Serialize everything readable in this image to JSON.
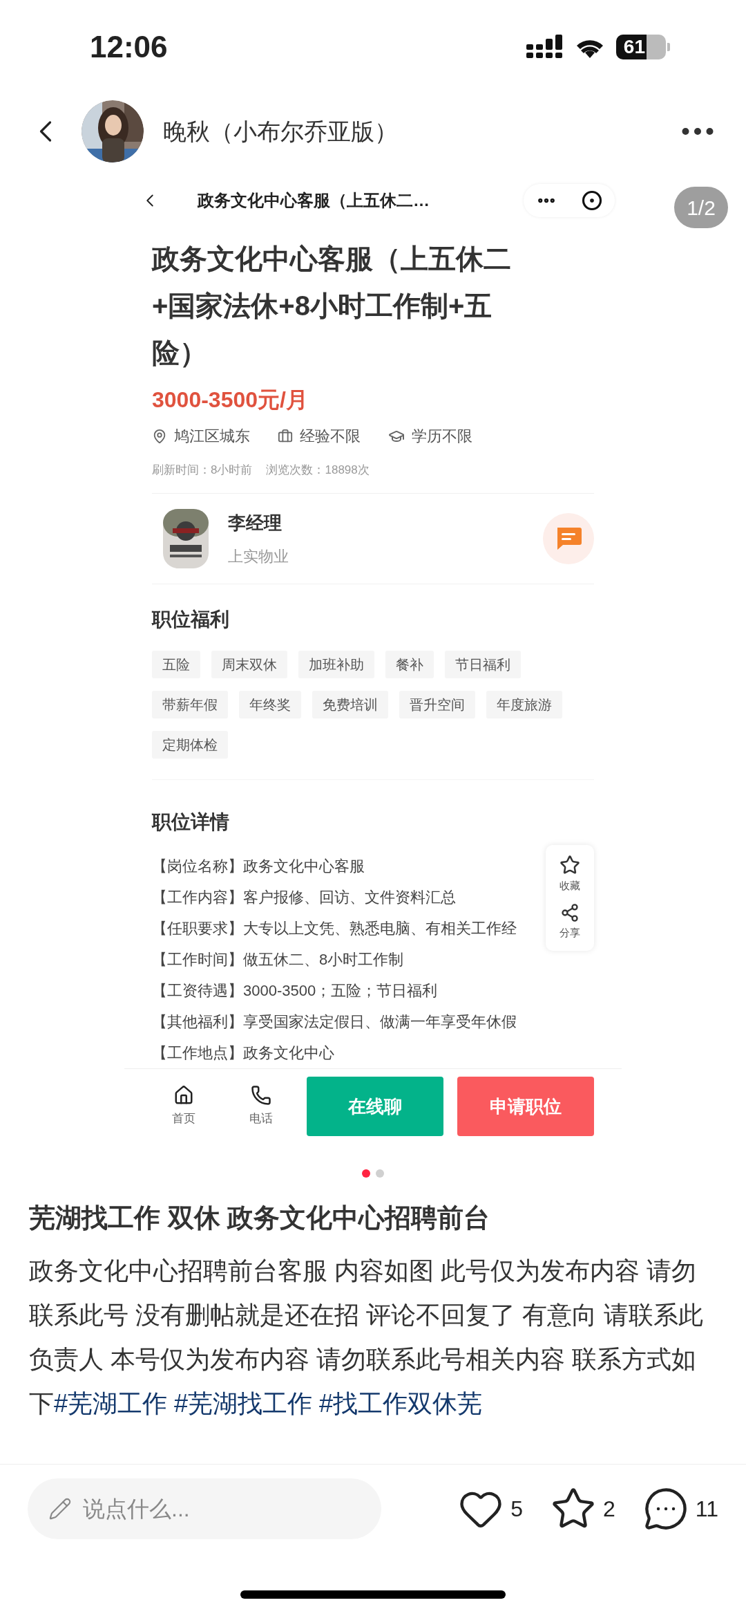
{
  "status_bar": {
    "time": "12:06",
    "battery": "61"
  },
  "header": {
    "name": "晚秋（小布尔乔亚版）"
  },
  "image_counter": "1/2",
  "job_page": {
    "nav_title": "政务文化中心客服（上五休二…",
    "title": "政务文化中心客服（上五休二+国家法休+8小时工作制+五险）",
    "salary": "3000-3500元/月",
    "requirements": [
      {
        "kind": "location",
        "text": "鸠江区城东"
      },
      {
        "kind": "experience",
        "text": "经验不限"
      },
      {
        "kind": "education",
        "text": "学历不限"
      }
    ],
    "refresh": "刷新时间：8小时前",
    "views": "浏览次数：18898次",
    "recruiter": {
      "name": "李经理",
      "company": "上实物业"
    },
    "benefits_heading": "职位福利",
    "benefits": [
      "五险",
      "周末双休",
      "加班补助",
      "餐补",
      "节日福利",
      "带薪年假",
      "年终奖",
      "免费培训",
      "晋升空间",
      "年度旅游",
      "定期体检"
    ],
    "details_heading": "职位详情",
    "details": [
      "【岗位名称】政务文化中心客服",
      "【工作内容】客户报修、回访、文件资料汇总",
      "【任职要求】大专以上文凭、熟悉电脑、有相关工作经",
      "【工作时间】做五休二、8小时工作制",
      "【工资待遇】3000-3500；五险；节日福利",
      "【其他福利】享受国家法定假日、做满一年享受年休假",
      "【工作地点】政务文化中心"
    ],
    "side_actions": [
      {
        "kind": "star",
        "label": "收藏"
      },
      {
        "kind": "share",
        "label": "分享"
      }
    ],
    "nav": [
      {
        "kind": "home",
        "label": "首页"
      },
      {
        "kind": "phone",
        "label": "电话"
      }
    ],
    "buttons": [
      {
        "kind": "chat",
        "label": "在线聊"
      },
      {
        "kind": "apply",
        "label": "申请职位"
      }
    ]
  },
  "page_dots": [
    {
      "selected": true
    },
    {
      "selected": false
    }
  ],
  "post": {
    "title": "芜湖找工作 双休 政务文化中心招聘前台",
    "body": "政务文化中心招聘前台客服 内容如图 此号仅为发布内容 请勿联系此号 没有删帖就是还在招 评论不回复了 有意向 请联系此负责人 本号仅为发布内容 请勿联系此号相关内容 联系方式如下",
    "tags": [
      "#芜湖工作",
      "#芜湖找工作",
      "#找工作双休芜"
    ]
  },
  "comment": {
    "placeholder": "说点什么..."
  },
  "actions": [
    {
      "kind": "like",
      "count": "5"
    },
    {
      "kind": "favorite",
      "count": "2"
    },
    {
      "kind": "comment",
      "count": "11"
    }
  ]
}
